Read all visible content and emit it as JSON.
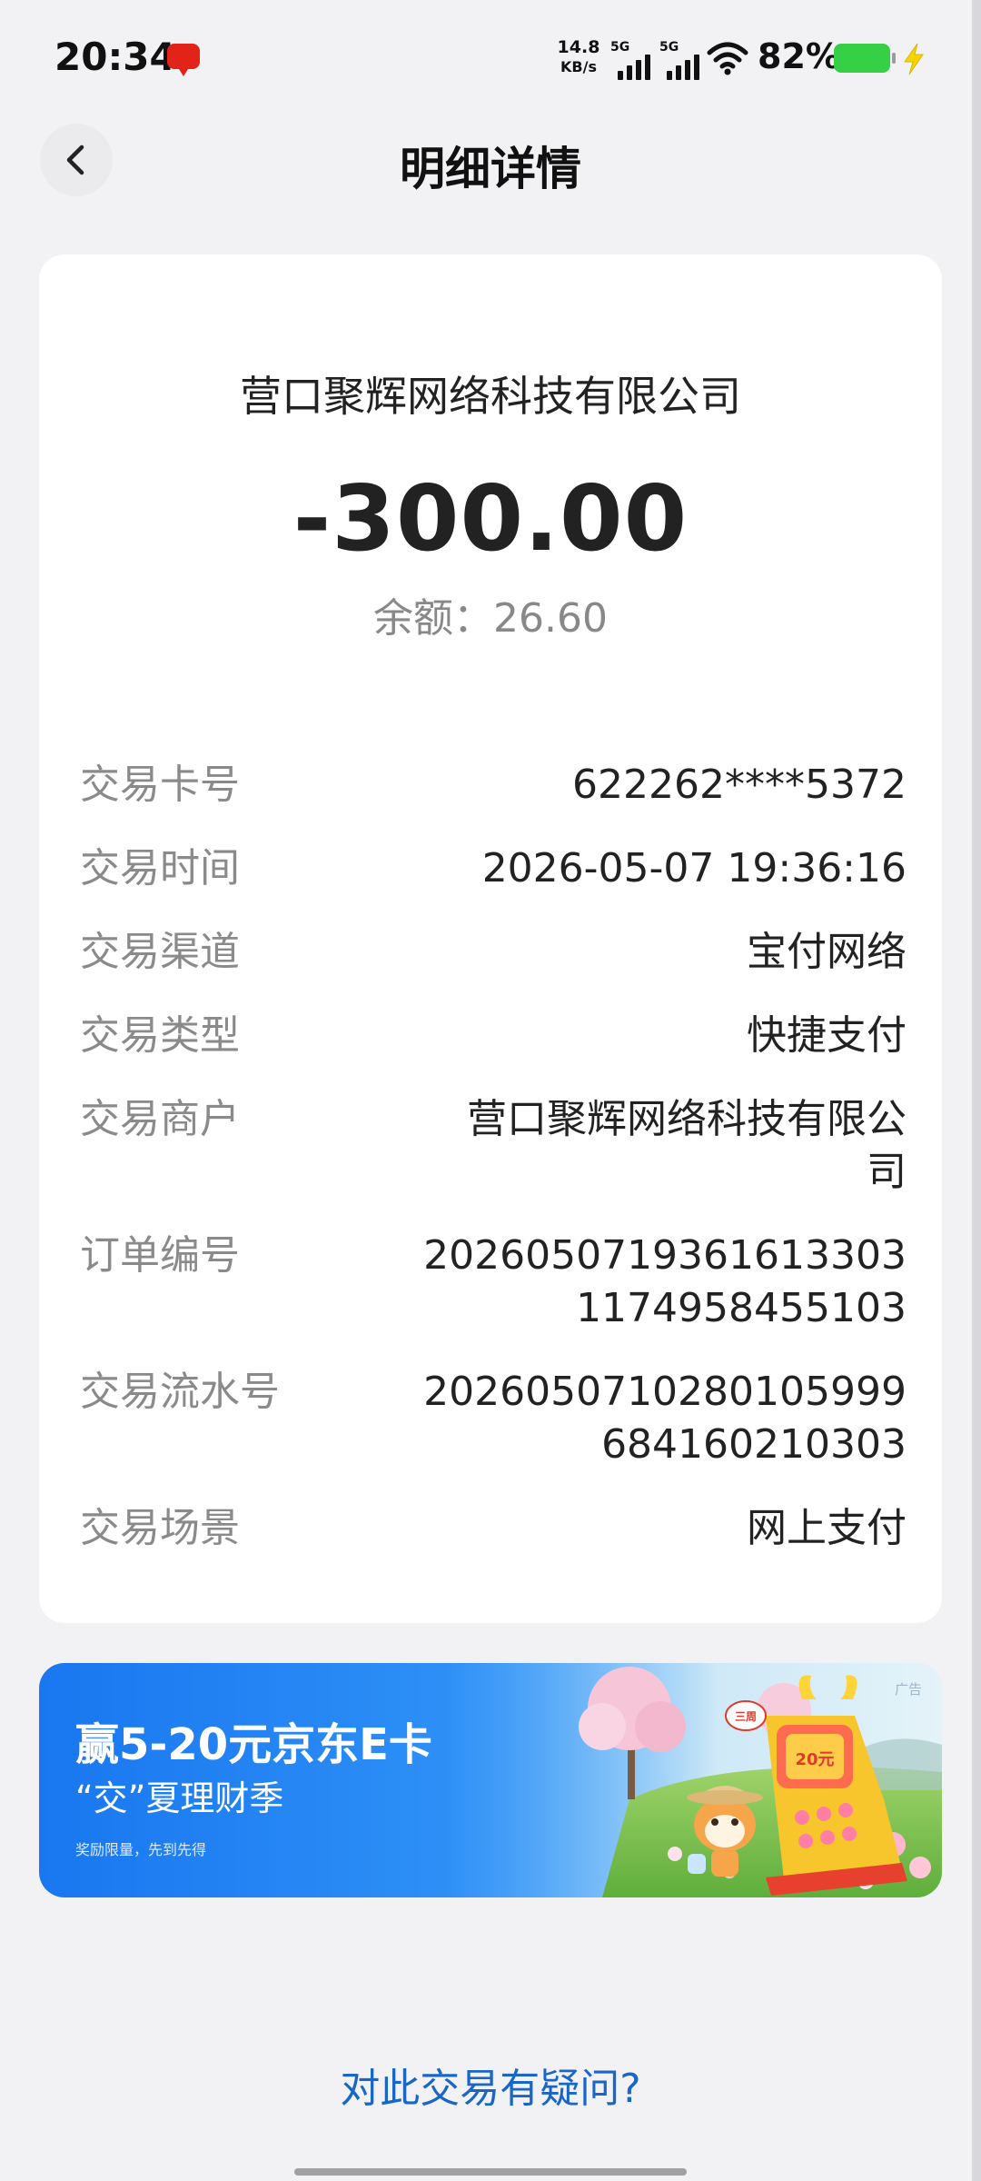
{
  "status_bar": {
    "time": "20:34",
    "net_speed_value": "14.8",
    "net_speed_unit": "KB/s",
    "signal_1_label": "5G",
    "signal_2_label": "5G",
    "battery_percent": "82%",
    "battery_level": 0.82,
    "battery_color": "#35d046"
  },
  "header": {
    "title": "明细详情",
    "back_icon": "chevron-left-icon"
  },
  "transaction": {
    "merchant": "营口聚辉网络科技有限公司",
    "amount": "-300.00",
    "balance": "余额：26.60",
    "details": [
      {
        "label": "交易卡号",
        "value": "622262****5372"
      },
      {
        "label": "交易时间",
        "value": "2026-05-07 19:36:16"
      },
      {
        "label": "交易渠道",
        "value": "宝付网络"
      },
      {
        "label": "交易类型",
        "value": "快捷支付"
      },
      {
        "label": "交易商户",
        "value": "营口聚辉网络科技有限公司"
      },
      {
        "label": "订单编号",
        "value": "20260507193616133031174958455103"
      },
      {
        "label": "交易流水号",
        "value": "20260507102801059996841602103​03"
      },
      {
        "label": "交易场景",
        "value": "网上支付"
      }
    ]
  },
  "ad": {
    "title": "赢5-20元京东E卡",
    "subtitle": "“交”夏理财季",
    "note": "奖励限量，先到先得",
    "tag": "广告",
    "badge_top": "三周",
    "badge_value": "20元",
    "accent": "#1977f0"
  },
  "footer": {
    "question_link": "对此交易有疑问?",
    "link_color": "#1a66c8"
  }
}
